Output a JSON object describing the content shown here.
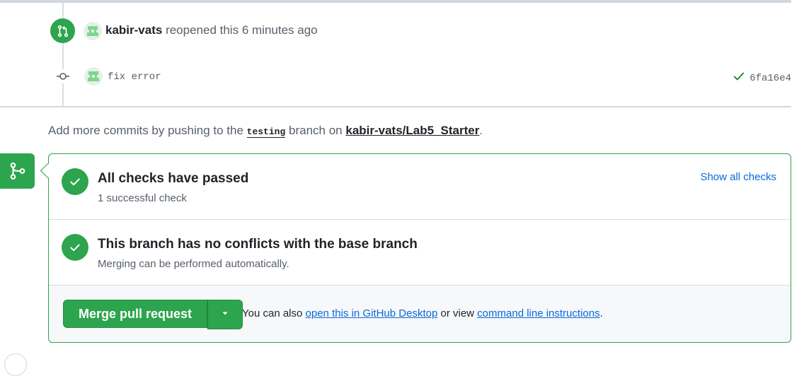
{
  "timeline": {
    "reopen_event": {
      "user": "kabir-vats",
      "action": "reopened this",
      "time": "6 minutes ago",
      "icon": "git-pull-request-icon"
    },
    "commit": {
      "message": "fix error",
      "sha": "6fa16e4",
      "status_icon": "check-icon"
    }
  },
  "push_hint": {
    "prefix": "Add more commits by pushing to the",
    "branch": "testing",
    "middle": "branch on",
    "repo": "kabir-vats/Lab5_Starter",
    "suffix": "."
  },
  "merge_box": {
    "checks": {
      "title": "All checks have passed",
      "subtitle": "1 successful check",
      "link": "Show all checks"
    },
    "conflicts": {
      "title": "This branch has no conflicts with the base branch",
      "subtitle": "Merging can be performed automatically."
    },
    "action": {
      "merge_label": "Merge pull request",
      "also_prefix": "You can also",
      "desktop_link": "open this in GitHub Desktop",
      "or_view": "or view",
      "cli_link": "command line instructions",
      "suffix": "."
    }
  },
  "colors": {
    "success": "#2da44e",
    "link": "#0969da",
    "muted": "#57606a",
    "border": "#d0d7de"
  }
}
